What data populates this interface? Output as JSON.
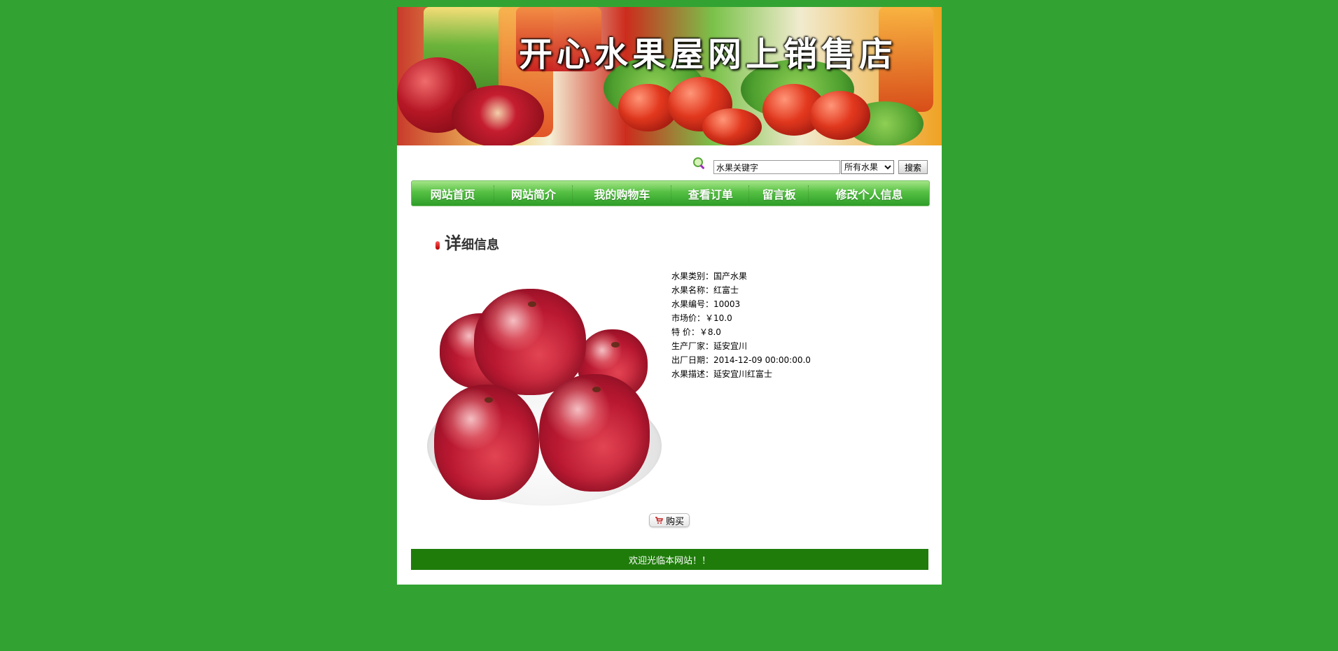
{
  "banner": {
    "title": "开心水果屋网上销售店"
  },
  "search": {
    "input_value": "水果关键字",
    "category_selected": "所有水果",
    "button_label": "搜索"
  },
  "nav": {
    "items": [
      {
        "label": "网站首页"
      },
      {
        "label": "网站简介"
      },
      {
        "label": "我的购物车"
      },
      {
        "label": "查看订单"
      },
      {
        "label": "留言板"
      },
      {
        "label": "修改个人信息"
      }
    ]
  },
  "section": {
    "title_first": "详",
    "title_rest": "细信息"
  },
  "product": {
    "details": [
      {
        "label": "水果类别：",
        "value": "国产水果"
      },
      {
        "label": "水果名称：",
        "value": "红富士"
      },
      {
        "label": "水果编号：",
        "value": "10003"
      },
      {
        "label": "市场价：",
        "value": "￥10.0"
      },
      {
        "label": "特  价：",
        "value": "￥8.0"
      },
      {
        "label": "生产厂家：",
        "value": "延安宜川"
      },
      {
        "label": "出厂日期：",
        "value": "2014-12-09 00:00:00.0"
      },
      {
        "label": "水果描述：",
        "value": "延安宜川红富士"
      }
    ],
    "buy_label": "购买"
  },
  "footer": {
    "text": "欢迎光临本网站！！"
  },
  "colors": {
    "page_background": "#32a332",
    "nav_green": "#55c043",
    "footer_green": "#1f7c0b",
    "accent_red": "#b30000"
  },
  "icons": {
    "search": "search-icon",
    "cart": "cart-icon",
    "title_marker": "red-pill-icon"
  }
}
